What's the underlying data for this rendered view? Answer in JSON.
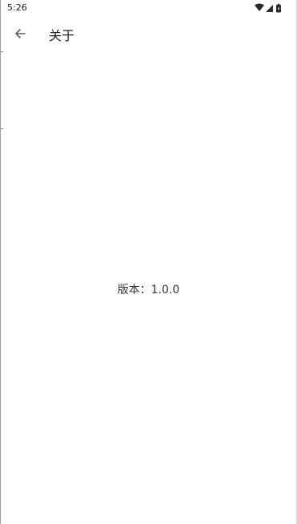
{
  "status_bar": {
    "time": "5:26",
    "icons": [
      "wifi-icon",
      "cellular-signal-icon",
      "battery-icon"
    ]
  },
  "app_bar": {
    "back_icon": "arrow-left-icon",
    "title": "关于"
  },
  "content": {
    "version_text": "版本：1.0.0"
  },
  "colors": {
    "background": "#ffffff",
    "text_primary": "#202020",
    "text_secondary": "#333333",
    "icon": "#5f5f5f"
  }
}
